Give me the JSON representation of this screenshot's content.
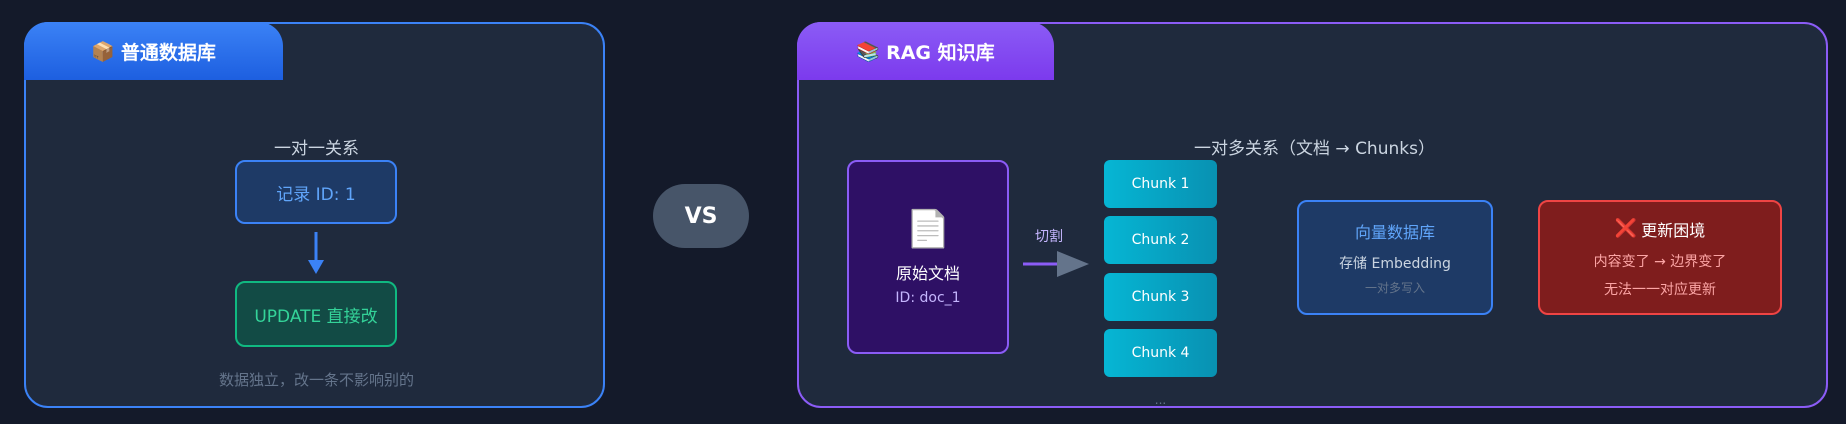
{
  "left": {
    "tab_icon": "📦",
    "tab_title": "普通数据库",
    "subtitle": "一对一关系",
    "record_label": "记录 ID: 1",
    "update_label": "UPDATE 直接改",
    "footnote": "数据独立，改一条不影响别的"
  },
  "vs_label": "VS",
  "right": {
    "tab_icon": "📚",
    "tab_title": "RAG 知识库",
    "subtitle": "一对多关系（文档 → Chunks）",
    "doc_icon": "📄",
    "doc_title": "原始文档",
    "doc_id": "ID: doc_1",
    "split_label": "切割",
    "chunks": [
      "Chunk 1",
      "Chunk 2",
      "Chunk 3",
      "Chunk 4"
    ],
    "ellipsis": "...",
    "vector_title": "向量数据库",
    "vector_line1": "存储 Embedding",
    "vector_line2": "一对多写入",
    "problem_icon": "❌",
    "problem_title": "更新困境",
    "problem_line1": "内容变了 → 边界变了",
    "problem_line2": "无法一一对应更新"
  },
  "colors": {
    "background": "#141a2a",
    "left_accent": "#3b82f6",
    "right_accent": "#8b5cf6",
    "chunk": "#06b6d4",
    "success": "#10b981",
    "danger": "#ef4444"
  }
}
